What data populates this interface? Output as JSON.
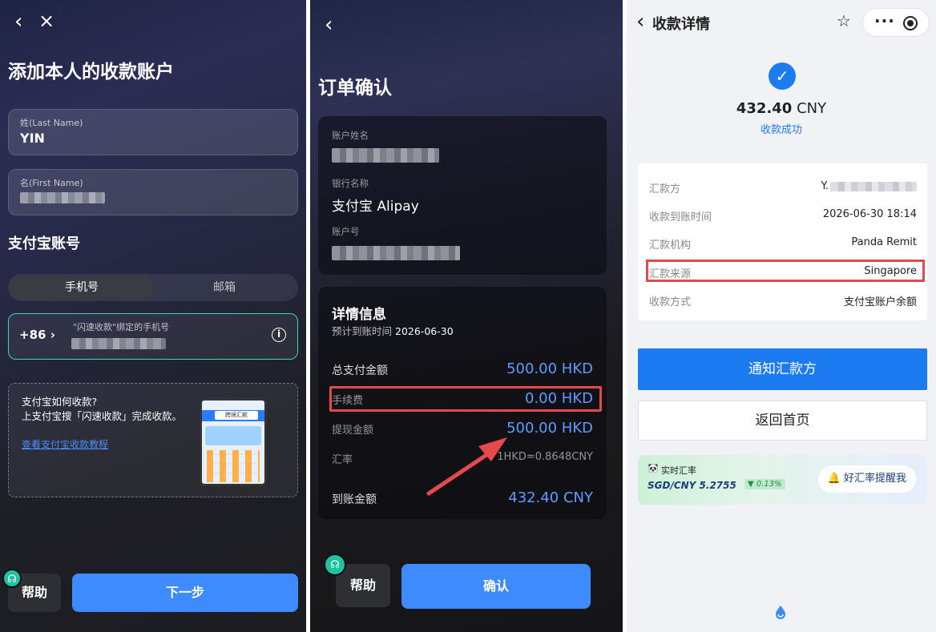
{
  "panel1": {
    "title": "添加本人的收款账户",
    "last_name_label": "姓(Last Name)",
    "last_name_value": "YIN",
    "first_name_label": "名(First Name)",
    "alipay_section": "支付宝账号",
    "tab_phone": "手机号",
    "tab_email": "邮箱",
    "country_code": "+86",
    "phone_label": "\"闪速收款\"绑定的手机号",
    "howto_question": "支付宝如何收款?",
    "howto_text": "上支付宝搜「闪速收款」完成收款。",
    "howto_link": "查看支付宝收款教程",
    "mock_search": "跨境汇款",
    "help": "帮助",
    "next": "下一步"
  },
  "panel2": {
    "title": "订单确认",
    "account_name_label": "账户姓名",
    "bank_label": "银行名称",
    "bank_value": "支付宝 Alipay",
    "account_no_label": "账户号",
    "detail_title": "详情信息",
    "eta_label": "预计到账时间",
    "eta_value": "2026-06-30",
    "rows": [
      {
        "label": "总支付金额",
        "value": "500.00 HKD"
      },
      {
        "label": "手续费",
        "value": "0.00 HKD"
      },
      {
        "label": "提现金额",
        "value": "500.00 HKD"
      },
      {
        "label": "汇率",
        "value": "1HKD=0.8648CNY"
      },
      {
        "label": "到账金额",
        "value": "432.40 CNY"
      }
    ],
    "help": "帮助",
    "confirm": "确认"
  },
  "panel3": {
    "nav_title": "收款详情",
    "amount": "432.40",
    "currency": "CNY",
    "status": "收款成功",
    "rows": [
      {
        "label": "汇款方",
        "value": "Y."
      },
      {
        "label": "收款到账时间",
        "value": "2026-06-30 18:14"
      },
      {
        "label": "汇款机构",
        "value": "Panda Remit"
      },
      {
        "label": "汇款来源",
        "value": "Singapore"
      },
      {
        "label": "收款方式",
        "value": "支付宝账户余额"
      }
    ],
    "notify_button": "通知汇款方",
    "home_button": "返回首页",
    "rate_title": "实时汇率",
    "rate_pair": "SGD/CNY 5.2755",
    "rate_change": "▼ 0.13%",
    "rate_remind": "好汇率提醒我"
  },
  "colors": {
    "accent_blue": "#3d8bff",
    "highlight_red": "#e5484d",
    "success_blue": "#1d7bf2",
    "green_border": "#3fd6a8"
  }
}
